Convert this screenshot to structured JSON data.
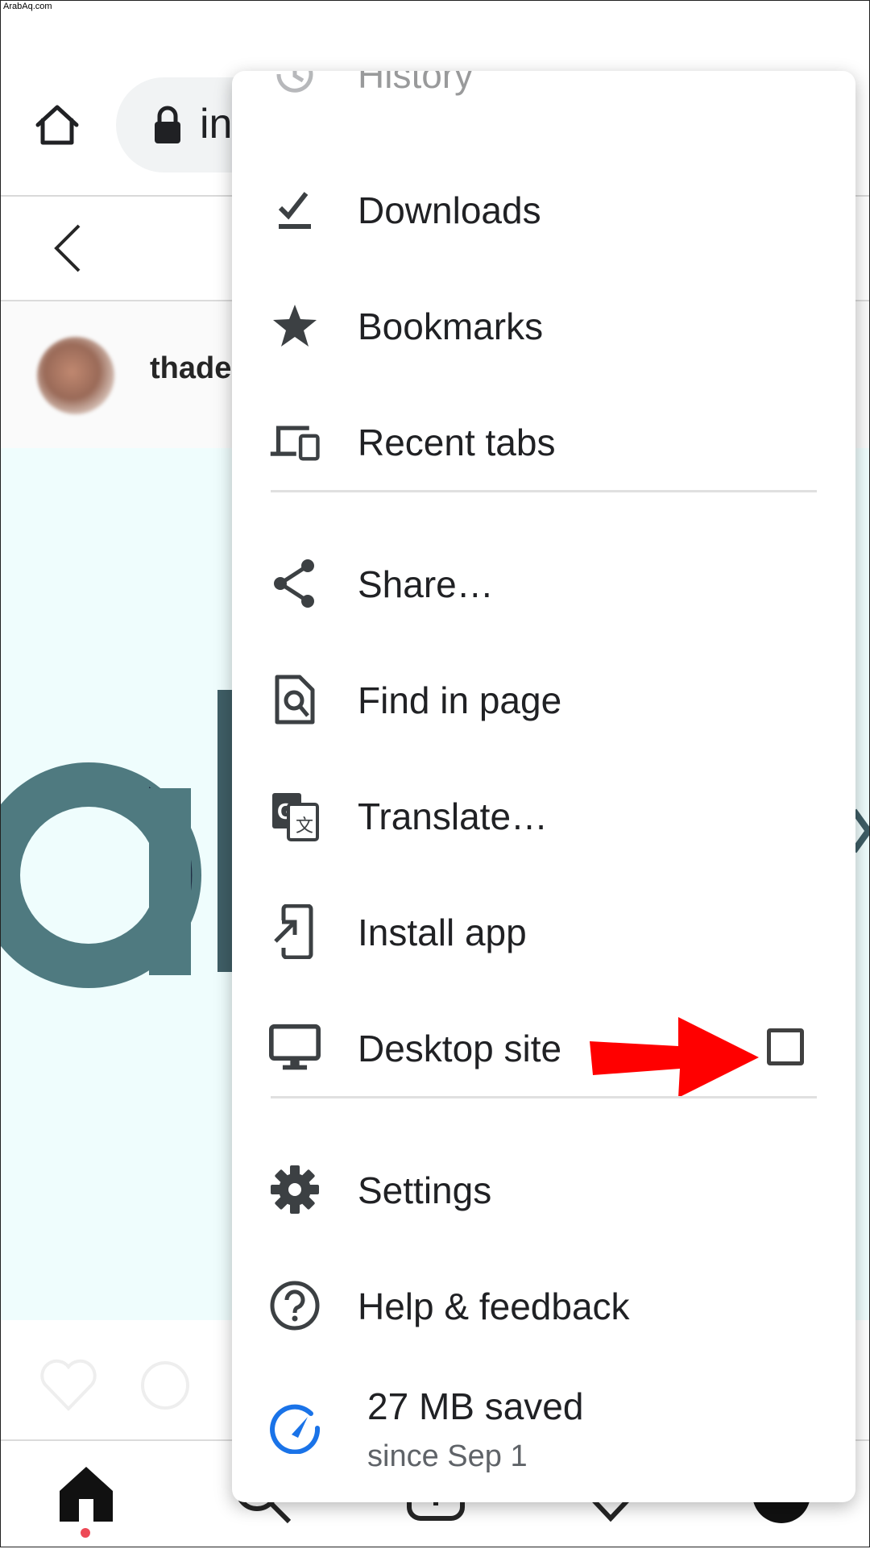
{
  "watermark": "ArabAq.com",
  "browser": {
    "url_fragment": "in",
    "home_icon": "home-icon",
    "lock_icon": "lock-icon"
  },
  "instagram": {
    "username": "thade"
  },
  "menu": {
    "history_label": "History",
    "items": [
      {
        "label": "Downloads",
        "icon": "download-check-icon"
      },
      {
        "label": "Bookmarks",
        "icon": "star-icon"
      },
      {
        "label": "Recent tabs",
        "icon": "devices-icon"
      },
      {
        "label": "Share…",
        "icon": "share-icon"
      },
      {
        "label": "Find in page",
        "icon": "find-in-page-icon"
      },
      {
        "label": "Translate…",
        "icon": "translate-icon"
      },
      {
        "label": "Install app",
        "icon": "install-app-icon"
      },
      {
        "label": "Desktop site",
        "icon": "desktop-icon"
      },
      {
        "label": "Settings",
        "icon": "gear-icon"
      },
      {
        "label": "Help & feedback",
        "icon": "help-icon"
      }
    ],
    "desktop_site_checked": false,
    "data_saved": {
      "title": "27 MB saved",
      "subtitle": "since Sep 1",
      "icon": "speedometer-icon"
    }
  },
  "colors": {
    "accent_red": "#ff0000",
    "data_saver_blue": "#1a73e8",
    "notification_dot": "#ed4956",
    "post_background": "#effdfd"
  }
}
